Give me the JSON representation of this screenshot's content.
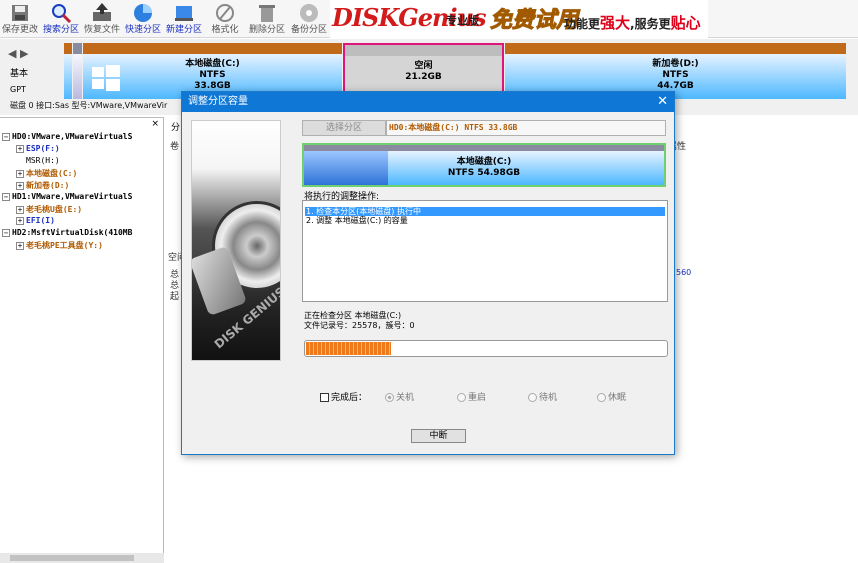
{
  "toolbar": {
    "buttons": [
      {
        "label": "保存更改",
        "icon": "save-icon"
      },
      {
        "label": "搜索分区",
        "icon": "magnifier-icon"
      },
      {
        "label": "恢复文件",
        "icon": "recover-icon"
      },
      {
        "label": "快速分区",
        "icon": "quick-partition-icon"
      },
      {
        "label": "新建分区",
        "icon": "new-partition-icon"
      },
      {
        "label": "格式化",
        "icon": "format-icon"
      },
      {
        "label": "删除分区",
        "icon": "trash-icon"
      },
      {
        "label": "备份分区",
        "icon": "backup-icon"
      }
    ]
  },
  "banner": {
    "logo": "DISKGenius",
    "edition": "专业版",
    "promo": "免费试用",
    "slogan_a": "功能更",
    "slogan_b": "强大",
    "slogan_c": ",服务更",
    "slogan_d": "贴心"
  },
  "diskbar": {
    "nav": "◀ ▶",
    "disk_type": "基本",
    "partition_style": "GPT",
    "info": "磁盘 0 接口:Sas  型号:VMware,VMwareVir",
    "partitions": [
      {
        "name": "本地磁盘(C:)",
        "fs": "NTFS",
        "size": "33.8GB"
      },
      {
        "name": "空闲",
        "fs": "21.2GB",
        "size": ""
      },
      {
        "name": "新加卷(D:)",
        "fs": "NTFS",
        "size": "44.7GB"
      }
    ]
  },
  "tree": {
    "close": "×",
    "items": [
      {
        "text": "HD0:VMware,VMwareVirtualS",
        "level": 0,
        "style": "disk"
      },
      {
        "text": "ESP(F:)",
        "level": 1,
        "style": "part"
      },
      {
        "text": "MSR(H:)",
        "level": 1,
        "style": "disk"
      },
      {
        "text": "本地磁盘(C:)",
        "level": 1,
        "style": "orange"
      },
      {
        "text": "新加卷(D:)",
        "level": 1,
        "style": "orange"
      },
      {
        "text": "HD1:VMware,VMwareVirtualS",
        "level": 0,
        "style": "disk"
      },
      {
        "text": "老毛桃U盘(E:)",
        "level": 1,
        "style": "orange"
      },
      {
        "text": "EFI(I)",
        "level": 1,
        "style": "part"
      },
      {
        "text": "HD2:MsftVirtualDisk(410MB",
        "level": 0,
        "style": "disk"
      },
      {
        "text": "老毛桃PE工具盘(Y:)",
        "level": 1,
        "style": "orange"
      }
    ]
  },
  "right_panel": {
    "tab": "分",
    "col_label": "卷",
    "attr_label": "属性",
    "free_label": "空间",
    "total_label": "总",
    "total2_label": "总",
    "start_label": "起",
    "value_fragment": "560"
  },
  "dialog": {
    "title": "调整分区容量",
    "close": "✕",
    "select_button": "选择分区",
    "selected_partition": "HD0:本地磁盘(C:) NTFS 33.8GB",
    "partition_name": "本地磁盘(C:)",
    "partition_detail": "NTFS 54.98GB",
    "ops_label": "将执行的调整操作:",
    "operations": [
      {
        "text": "1. 检查本分区(本地磁盘)   执行中",
        "active": true
      },
      {
        "text": "2. 调整 本地磁盘(C:) 的容量",
        "active": false
      }
    ],
    "status_line1": "正在检查分区 本地磁盘(C:)",
    "status_line2": "文件记录号：25578，簇号：0",
    "progress": 0.24,
    "after_done_label": "完成后：",
    "after_options": [
      "关机",
      "重启",
      "待机",
      "休眠"
    ],
    "stop_button": "中断",
    "side_label": "DISK GENIUS"
  }
}
